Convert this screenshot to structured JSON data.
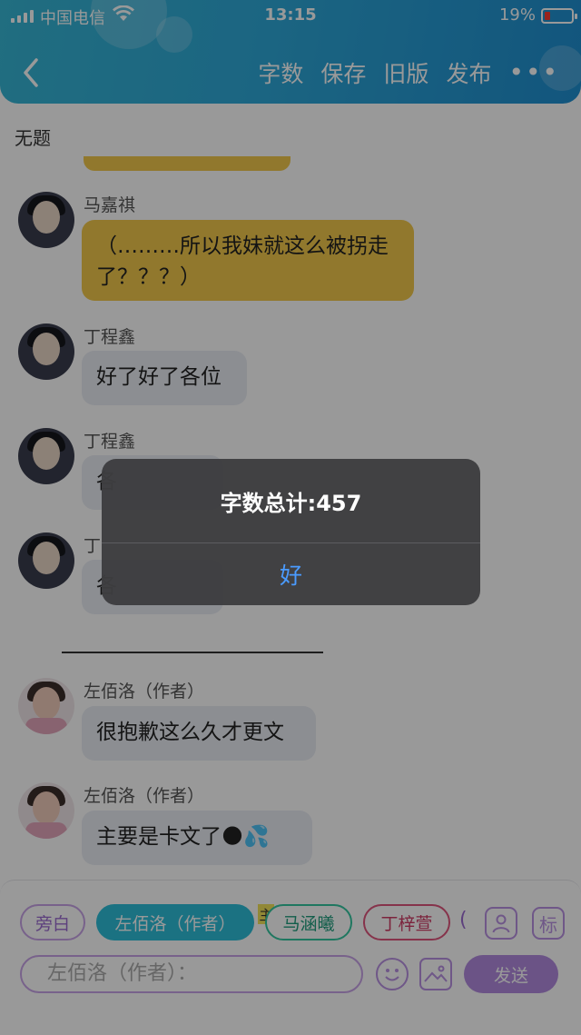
{
  "status_bar": {
    "carrier": "中国电信",
    "time": "13:15",
    "battery": "19%"
  },
  "header": {
    "actions": [
      "字数",
      "保存",
      "旧版",
      "发布"
    ],
    "more": "•••"
  },
  "doc_title": "无题",
  "messages": [
    {
      "name": "马嘉祺",
      "text": "（………所以我妹就这么被拐走了？？？）"
    },
    {
      "name": "丁程鑫",
      "text": "好了好了各位"
    },
    {
      "name": "丁程鑫",
      "text": "各"
    },
    {
      "name": "丁",
      "text": "各"
    },
    {
      "name": "左佰洛（作者）",
      "text": "很抱歉这么久才更文"
    },
    {
      "name": "左佰洛（作者）",
      "text": "主要是卡文了🌑💦"
    }
  ],
  "composer": {
    "chips": [
      "旁白",
      "左佰洛（作者）",
      "马涵曦",
      "丁梓萱"
    ],
    "chip_overflow": "(",
    "main_badge": "主",
    "tag_button": "标",
    "input_placeholder": "左佰洛（作者）：",
    "send": "发送"
  },
  "alert": {
    "message": "字数总计:457",
    "ok": "好"
  },
  "colors": {
    "header_start": "#37b7d6",
    "header_end": "#1f8fd1",
    "bubble_yellow": "#f2c94c",
    "bubble_gray": "#eaedf4",
    "accent_purple": "#b28be0",
    "alert_link": "#4a9bff"
  }
}
